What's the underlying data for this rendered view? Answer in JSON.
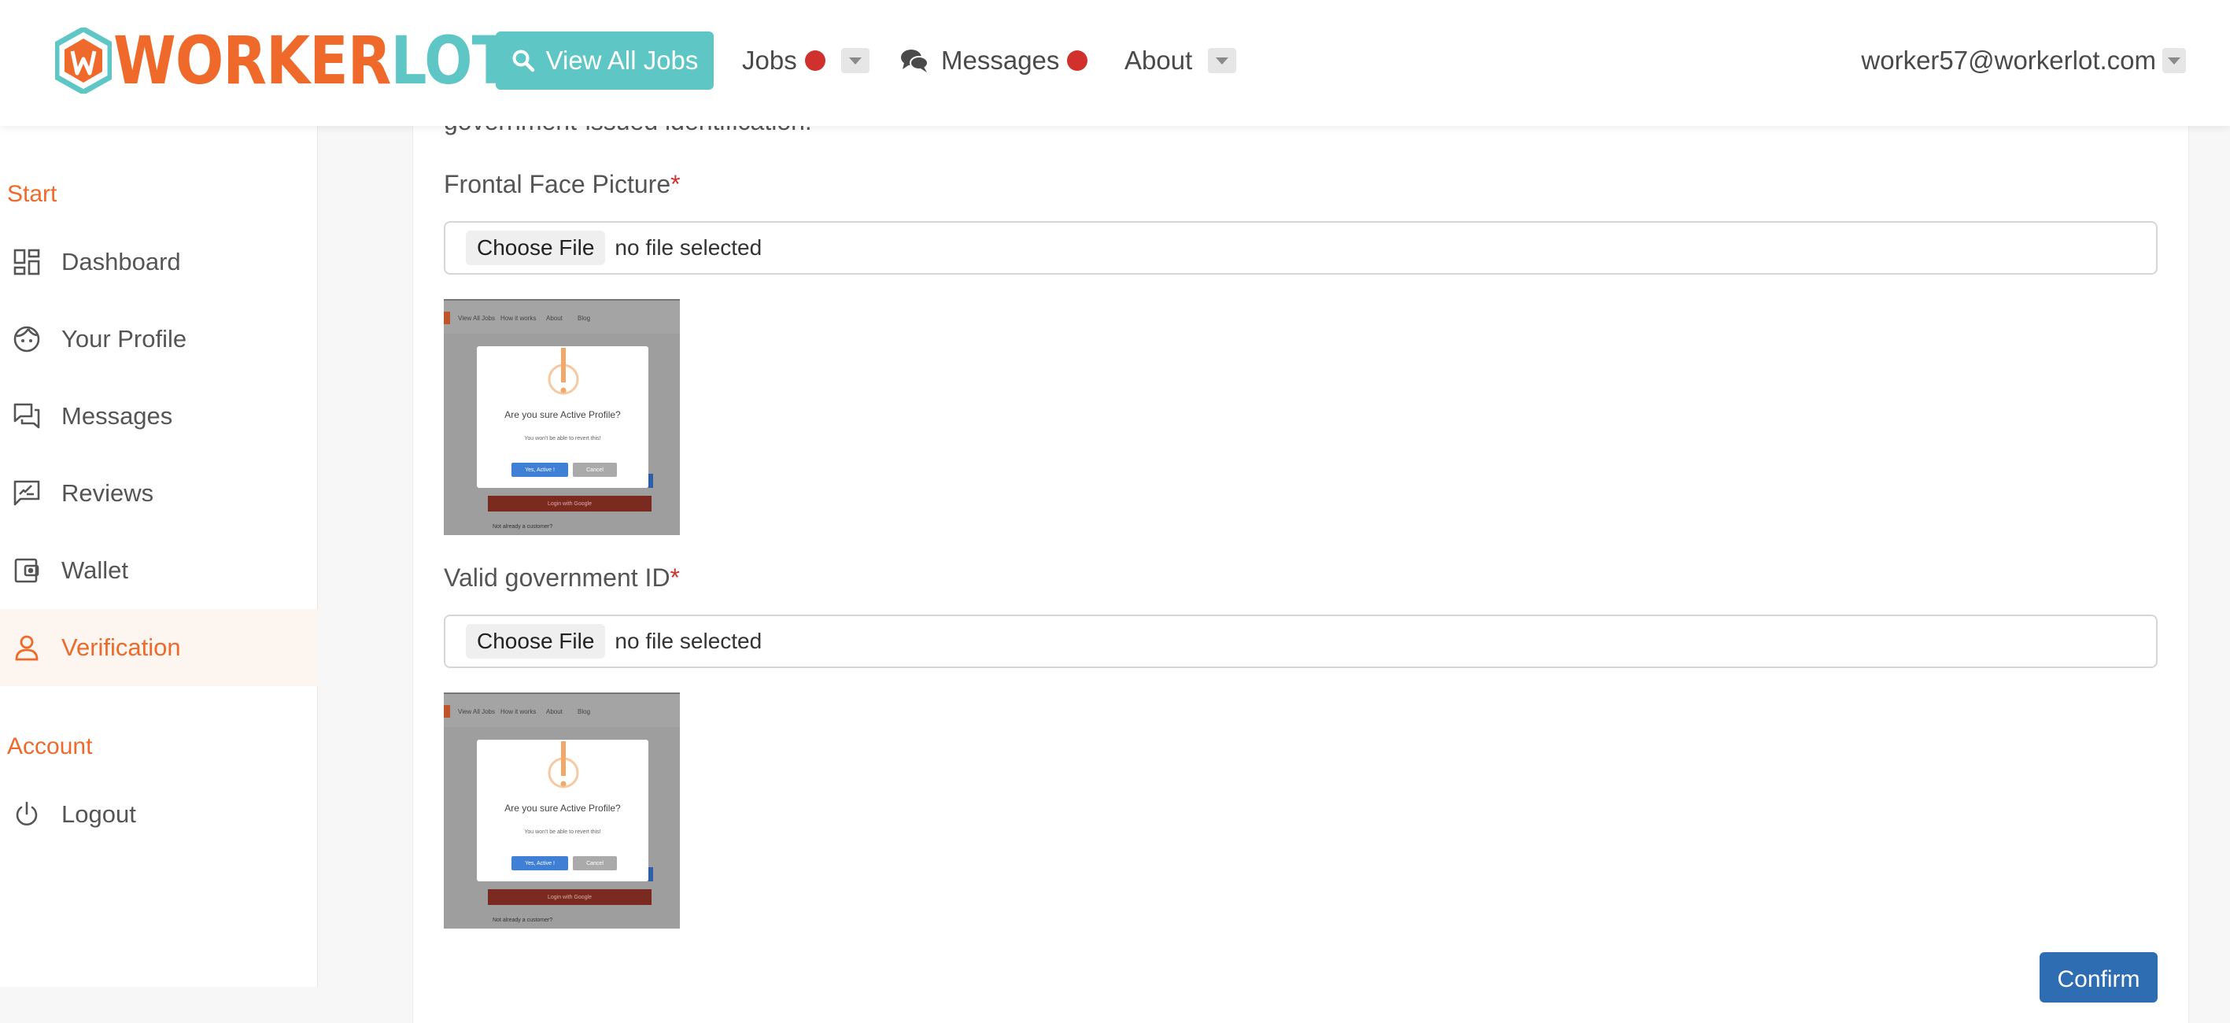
{
  "header": {
    "logo": {
      "part1": "WORKER",
      "part2": "LOT"
    },
    "view_all_jobs": "View All Jobs",
    "nav": {
      "jobs": "Jobs",
      "messages": "Messages",
      "about": "About"
    },
    "user_email": "worker57@workerlot.com"
  },
  "sidebar": {
    "section_start": "Start",
    "items": [
      {
        "label": "Dashboard",
        "icon": "dashboard-icon"
      },
      {
        "label": "Your Profile",
        "icon": "face-icon"
      },
      {
        "label": "Messages",
        "icon": "chat-icon"
      },
      {
        "label": "Reviews",
        "icon": "review-icon"
      },
      {
        "label": "Wallet",
        "icon": "wallet-icon"
      },
      {
        "label": "Verification",
        "icon": "user-icon",
        "active": true
      }
    ],
    "section_account": "Account",
    "logout": {
      "label": "Logout",
      "icon": "power-icon"
    }
  },
  "main": {
    "intro_text": "government-issued identification.",
    "fields": [
      {
        "label": "Frontal Face Picture",
        "required_mark": "*",
        "choose_file": "Choose File",
        "status": "no file selected"
      },
      {
        "label": "Valid government ID",
        "required_mark": "*",
        "choose_file": "Choose File",
        "status": "no file selected"
      }
    ],
    "preview": {
      "nav1": "View All Jobs",
      "nav2": "How it works",
      "nav3": "About",
      "nav4": "Blog",
      "question": "Are you sure Active Profile?",
      "subtext": "You won't be able to revert this!",
      "yes": "Yes, Active !",
      "cancel": "Cancel",
      "google": "Login with Google",
      "footer": "Not already a customer?"
    },
    "confirm": "Confirm"
  },
  "colors": {
    "brand_orange": "#ef6a2a",
    "brand_teal": "#5ec7c6",
    "notification_red": "#d0312d",
    "confirm_blue": "#2f6db3"
  }
}
